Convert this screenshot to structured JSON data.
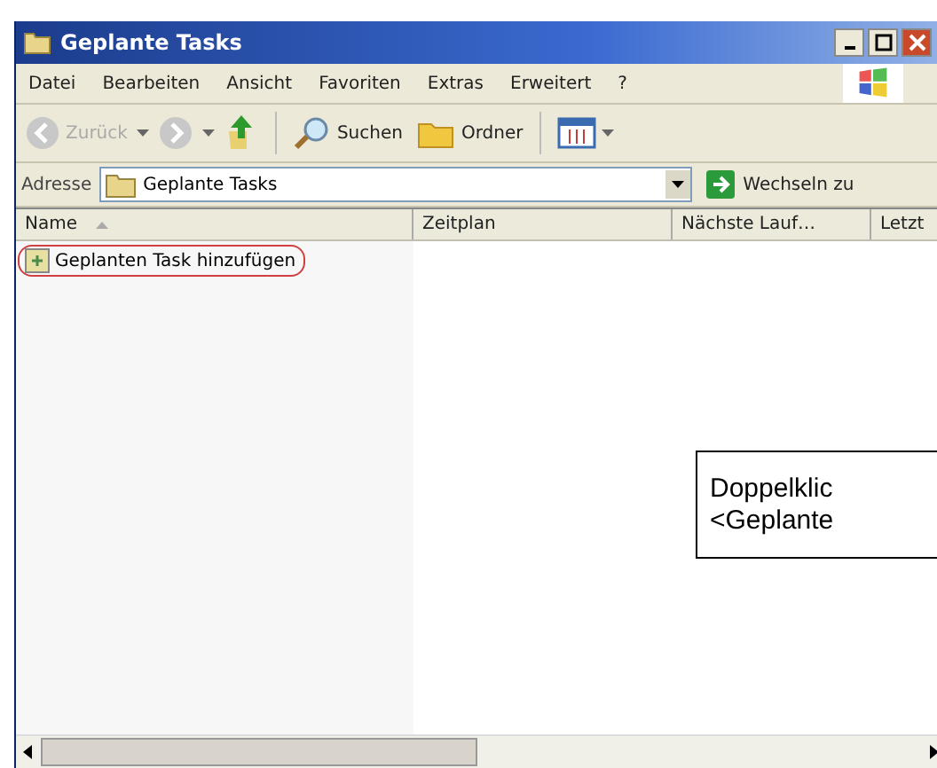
{
  "window": {
    "title": "Geplante Tasks"
  },
  "menu": [
    "Datei",
    "Bearbeiten",
    "Ansicht",
    "Favoriten",
    "Extras",
    "Erweitert",
    "?"
  ],
  "toolbar": {
    "back": {
      "label": "Zurück",
      "disabled": true
    },
    "search": "Suchen",
    "folders": "Ordner"
  },
  "address": {
    "label": "Adresse",
    "value": "Geplante Tasks",
    "go": "Wechseln zu"
  },
  "columns": [
    {
      "label": "Name",
      "sorted": true
    },
    {
      "label": "Zeitplan"
    },
    {
      "label": "Nächste Lauf…"
    },
    {
      "label": "Letzt"
    }
  ],
  "rows": [
    {
      "name": "Geplanten Task hinzufügen",
      "circled": true
    }
  ],
  "callout": [
    "Doppelklic",
    "<Geplante"
  ]
}
